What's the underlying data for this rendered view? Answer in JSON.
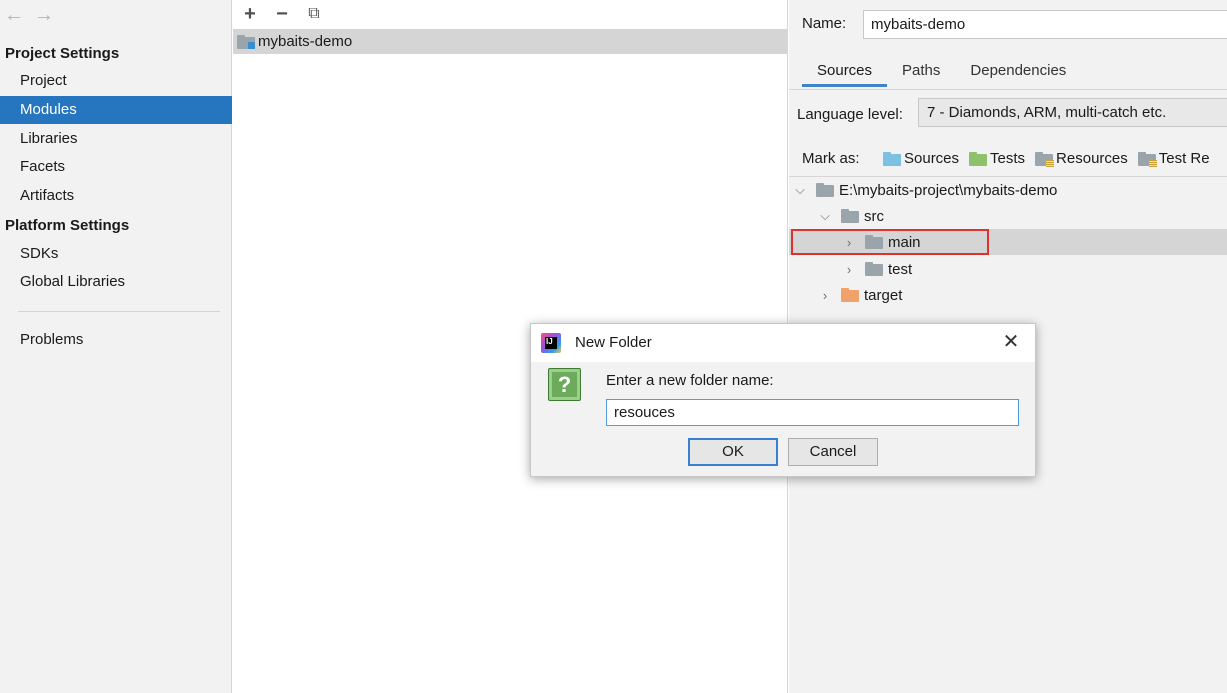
{
  "sidebar": {
    "nav": {
      "back": "←",
      "forward": "→"
    },
    "project_settings_title": "Project Settings",
    "project_items": [
      "Project",
      "Modules",
      "Libraries",
      "Facets",
      "Artifacts"
    ],
    "platform_settings_title": "Platform Settings",
    "platform_items": [
      "SDKs",
      "Global Libraries"
    ],
    "problems": "Problems",
    "selected": "Modules"
  },
  "middle": {
    "toolbar": {
      "add": "+",
      "remove": "−",
      "copy": "⧉"
    },
    "module": "mybaits-demo"
  },
  "right": {
    "name_label": "Name:",
    "name_value": "mybaits-demo",
    "tabs": [
      "Sources",
      "Paths",
      "Dependencies"
    ],
    "active_tab": "Sources",
    "language_label": "Language level:",
    "language_value": "7 - Diamonds, ARM, multi-catch etc.",
    "mark_as_label": "Mark as:",
    "mark_as": [
      "Sources",
      "Tests",
      "Resources",
      "Test Re"
    ],
    "tree": {
      "root": "E:\\mybaits-project\\mybaits-demo",
      "src": "src",
      "main": "main",
      "test": "test",
      "target": "target"
    }
  },
  "dialog": {
    "title": "New Folder",
    "close": "✕",
    "icon": "?",
    "prompt": "Enter a new folder name:",
    "input_value": "resouces",
    "ok": "OK",
    "cancel": "Cancel"
  },
  "colors": {
    "selection": "#2675bf",
    "highlight": "#e03131",
    "source_folder": "#7cc0e3",
    "test_folder": "#8fc06b",
    "excluded_folder": "#f0a26a"
  }
}
